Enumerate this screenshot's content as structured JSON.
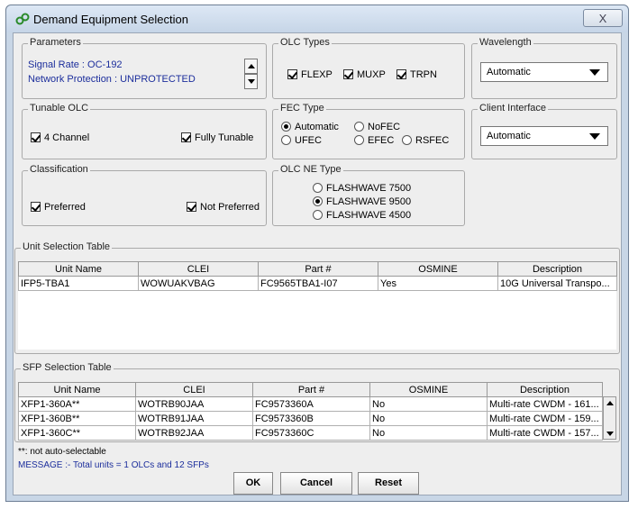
{
  "window": {
    "title": "Demand Equipment Selection",
    "close_label": "X"
  },
  "parameters": {
    "legend": "Parameters",
    "signal_rate": "Signal Rate : OC-192",
    "network_protection": "Network Protection : UNPROTECTED"
  },
  "olc_types": {
    "legend": "OLC Types",
    "options": [
      "FLEXP",
      "MUXP",
      "TRPN"
    ]
  },
  "wavelength": {
    "legend": "Wavelength",
    "value": "Automatic"
  },
  "tunable_olc": {
    "legend": "Tunable OLC",
    "four_channel": "4 Channel",
    "fully_tunable": "Fully Tunable"
  },
  "fec_type": {
    "legend": "FEC Type",
    "options": [
      "Automatic",
      "NoFEC",
      "UFEC",
      "EFEC",
      "RSFEC"
    ],
    "selected": "Automatic"
  },
  "client_interface": {
    "legend": "Client Interface",
    "value": "Automatic"
  },
  "classification": {
    "legend": "Classification",
    "preferred": "Preferred",
    "not_preferred": "Not Preferred"
  },
  "olc_ne_type": {
    "legend": "OLC NE Type",
    "options": [
      "FLASHWAVE 7500",
      "FLASHWAVE 9500",
      "FLASHWAVE 4500"
    ],
    "selected": "FLASHWAVE 9500"
  },
  "unit_table": {
    "legend": "Unit Selection Table",
    "columns": [
      "Unit Name",
      "CLEI",
      "Part #",
      "OSMINE",
      "Description"
    ],
    "rows": [
      [
        "IFP5-TBA1",
        "WOWUAKVBAG",
        "FC9565TBA1-I07",
        "Yes",
        "10G Universal Transpo..."
      ]
    ]
  },
  "sfp_table": {
    "legend": "SFP Selection Table",
    "columns": [
      "Unit Name",
      "CLEI",
      "Part #",
      "OSMINE",
      "Description"
    ],
    "rows": [
      [
        "XFP1-360A**",
        "WOTRB90JAA",
        "FC9573360A",
        "No",
        "Multi-rate CWDM - 161..."
      ],
      [
        "XFP1-360B**",
        "WOTRB91JAA",
        "FC9573360B",
        "No",
        "Multi-rate CWDM - 159..."
      ],
      [
        "XFP1-360C**",
        "WOTRB92JAA",
        "FC9573360C",
        "No",
        "Multi-rate CWDM - 157..."
      ]
    ]
  },
  "footer": {
    "note": "**: not auto-selectable",
    "message": "MESSAGE :- Total units = 1 OLCs and 12 SFPs"
  },
  "buttons": {
    "ok": "OK",
    "cancel": "Cancel",
    "reset": "Reset"
  }
}
